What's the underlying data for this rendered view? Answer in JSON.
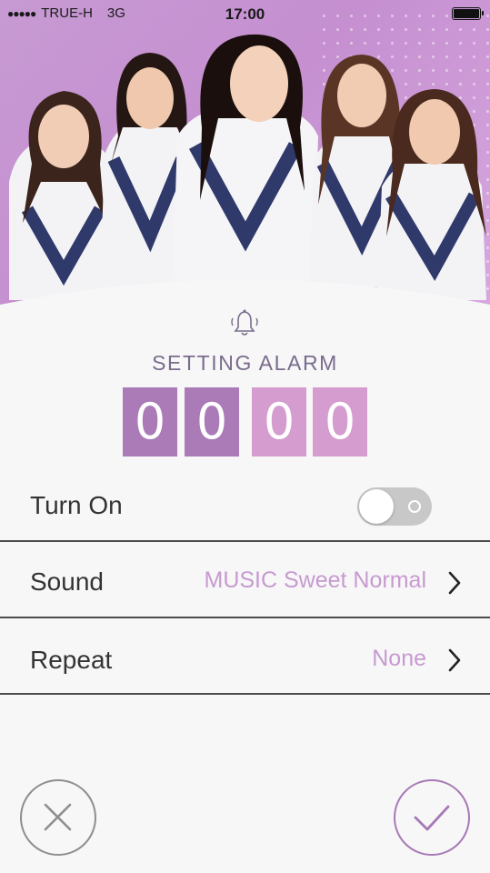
{
  "status_bar": {
    "carrier": "TRUE-H",
    "network": "3G",
    "time": "17:00",
    "signal_bars": "●●●●●"
  },
  "alarm": {
    "title": "SETTING ALARM",
    "digits": [
      "0",
      "0",
      "0",
      "0"
    ]
  },
  "settings": {
    "turn_on": {
      "label": "Turn On",
      "enabled": false
    },
    "sound": {
      "label": "Sound",
      "value": "MUSIC Sweet Normal"
    },
    "repeat": {
      "label": "Repeat",
      "value": "None"
    }
  },
  "icons": {
    "bell": "bell-icon",
    "chevron": "chevron-right-icon",
    "cancel": "close-icon",
    "confirm": "check-icon"
  },
  "colors": {
    "hero_background": "#c58fd0",
    "digit_dark": "#ab7bb8",
    "digit_light": "#d59ccf",
    "value_text": "#c79ad0",
    "title_text": "#7a6b8c",
    "confirm_accent": "#a878b6"
  }
}
